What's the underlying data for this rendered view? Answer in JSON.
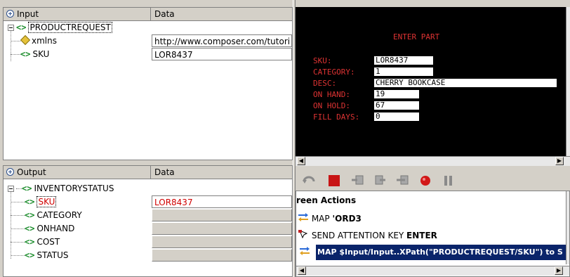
{
  "input": {
    "col1": "Input",
    "col2": "Data",
    "root": "PRODUCTREQUEST",
    "rows": [
      {
        "name": "xmlns",
        "value": "http://www.composer.com/tutori"
      },
      {
        "name": "SKU",
        "value": "LOR8437"
      }
    ]
  },
  "output": {
    "col1": "Output",
    "col2": "Data",
    "root": "INVENTORYSTATUS",
    "rows": [
      {
        "name": "SKU",
        "value": "LOR8437"
      },
      {
        "name": "CATEGORY",
        "value": ""
      },
      {
        "name": "ONHAND",
        "value": ""
      },
      {
        "name": "COST",
        "value": ""
      },
      {
        "name": "STATUS",
        "value": ""
      }
    ]
  },
  "terminal": {
    "title": "ENTER PART",
    "fields": [
      {
        "label": "SKU:",
        "value": "LOR8437"
      },
      {
        "label": "CATEGORY:",
        "value": "1"
      },
      {
        "label": "DESC:",
        "value": "CHERRY BOOKCASE"
      },
      {
        "label": "ON HAND:",
        "value": "19"
      },
      {
        "label": "ON HOLD:",
        "value": "67"
      },
      {
        "label": "FILL DAYS:",
        "value": "0"
      }
    ]
  },
  "screen_actions": {
    "title": "reen Actions",
    "items": [
      {
        "prefix": "MAP ",
        "bold": "'ORD3",
        "icon": "map-icon"
      },
      {
        "prefix": "SEND ATTENTION KEY ",
        "bold": "ENTER",
        "icon": "send-key-icon"
      },
      {
        "prefix": "",
        "bold": "MAP $Input/Input..XPath(\"PRODUCTREQUEST/SKU\") to S",
        "icon": "map-icon"
      }
    ]
  },
  "colors": {
    "terminal_text": "#dd3333",
    "selected": "#0a246a",
    "tag_green": "#1a8c2a",
    "red_value": "#d00000"
  }
}
